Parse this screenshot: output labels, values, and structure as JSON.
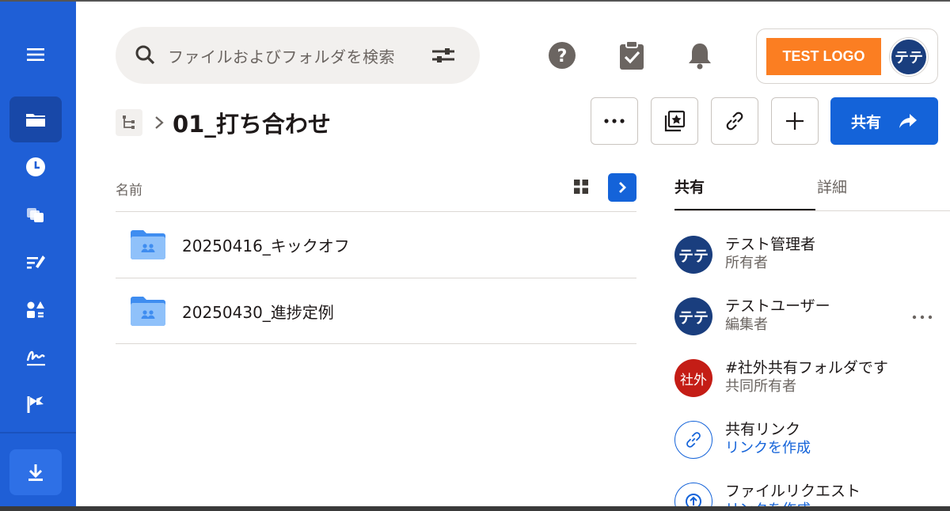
{
  "search": {
    "placeholder": "ファイルおよびフォルダを検索"
  },
  "account": {
    "logo_text": "TEST LOGO",
    "avatar_initials": "テテ"
  },
  "breadcrumb": {
    "title": "01_打ち合わせ"
  },
  "toolbar": {
    "share_label": "共有"
  },
  "file_list": {
    "column_name": "名前",
    "items": [
      {
        "name": "20250416_キックオフ",
        "icon": "shared-folder-icon"
      },
      {
        "name": "20250430_進捗定例",
        "icon": "shared-folder-icon"
      }
    ]
  },
  "side_panel": {
    "tabs": [
      {
        "label": "共有",
        "active": true
      },
      {
        "label": "詳細",
        "active": false
      }
    ],
    "members": [
      {
        "avatar": "テテ",
        "name": "テスト管理者",
        "role": "所有者"
      },
      {
        "avatar": "テテ",
        "name": "テストユーザー",
        "role": "編集者"
      },
      {
        "avatar": "社外",
        "name": "#社外共有フォルダです",
        "role": "共同所有者"
      }
    ],
    "share_link": {
      "title": "共有リンク",
      "action": "リンクを作成"
    },
    "file_request": {
      "title": "ファイルリクエスト",
      "action": "リンクを作成"
    }
  },
  "colors": {
    "sidebar": "#1f5fd6",
    "primary": "#1463d9",
    "logo": "#fb7e22",
    "avatar": "#1a3e7e",
    "external_avatar": "#c41d16"
  }
}
